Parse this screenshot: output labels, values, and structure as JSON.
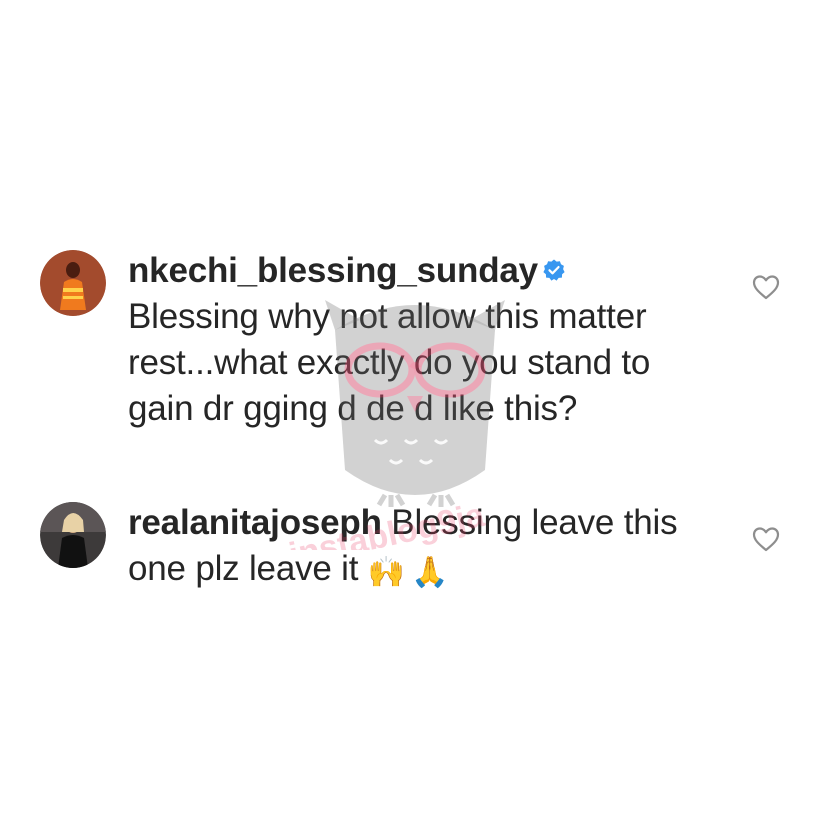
{
  "comments": [
    {
      "username": "nkechi_blessing_sunday",
      "verified": true,
      "text": "Blessing why not allow this matter rest...what exactly do you stand to gain dr gging d de d like this?",
      "like_icon": "heart-outline-icon",
      "avatar_icon": "profile-photo-avatar"
    },
    {
      "username": "realanitajoseph",
      "verified": false,
      "text": "Blessing leave this one plz leave it",
      "emojis": [
        "🙌",
        "🙏"
      ],
      "like_icon": "heart-outline-icon",
      "avatar_icon": "profile-photo-avatar"
    }
  ],
  "watermark": {
    "text": "instablog9ja",
    "mascot_icon": "owl-mascot-icon"
  },
  "colors": {
    "text": "#262626",
    "verified_badge": "#3897f0",
    "heart_outline": "#8e8e8e",
    "watermark_pink": "#e8446b",
    "watermark_grey": "#6b6b6b"
  }
}
